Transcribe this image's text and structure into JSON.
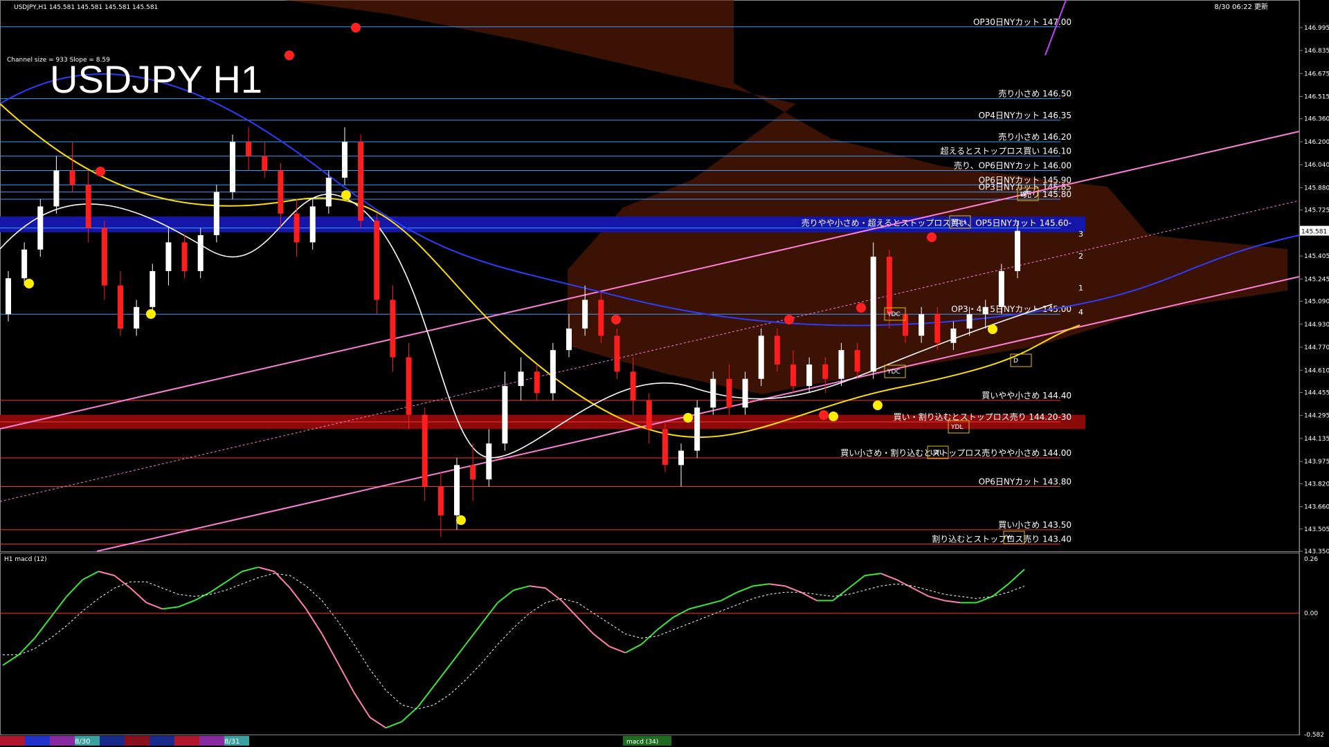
{
  "header": {
    "instrument_line": "USDJPY,H1  145.581 145.581 145.581 145.581",
    "timestamp": "8/30 06:22 更新",
    "channel_info": "Channel size = 933 Slope = 8.59"
  },
  "chart_data": {
    "type": "candlestick",
    "title": "USDJPY H1",
    "last_price": "145.581",
    "main_ylim": [
      143.35,
      147.1
    ],
    "main_ticks": [
      "146.995",
      "146.835",
      "146.675",
      "146.515",
      "146.360",
      "146.200",
      "146.040",
      "145.880",
      "145.725",
      "145.581",
      "145.405",
      "145.245",
      "145.090",
      "144.930",
      "144.770",
      "144.610",
      "144.455",
      "144.295",
      "144.135",
      "143.975",
      "143.820",
      "143.660",
      "143.505",
      "143.350"
    ],
    "levels": [
      {
        "price": 147.0,
        "label": "OP30日NYカット 147.00",
        "color": "#3a9bff"
      },
      {
        "price": 146.5,
        "label": "売り小さめ 146.50",
        "color": "#3a9bff"
      },
      {
        "price": 146.35,
        "label": "OP4日NYカット 146.35",
        "color": "#3a9bff"
      },
      {
        "price": 146.2,
        "label": "売り小さめ 146.20",
        "color": "#3a9bff"
      },
      {
        "price": 146.1,
        "label": "超えるとストップロス買い 146.10",
        "color": "#3a9bff"
      },
      {
        "price": 146.0,
        "label": "売り、OP6日NYカット 146.00",
        "color": "#3a9bff"
      },
      {
        "price": 145.9,
        "label": "OP6日NYカット 145.90",
        "color": "#3a9bff"
      },
      {
        "price": 145.85,
        "label": "OP3日NYカット 145.85",
        "color": "#3a9bff"
      },
      {
        "price": 145.8,
        "label": "売り 145.80",
        "color": "#3a9bff"
      },
      {
        "price": 145.6,
        "label": "売りやや小さめ・超えるとストップロス買い、OP5日NYカット 145.60-",
        "color": "#3a9bff"
      },
      {
        "price": 145.0,
        "label": "OP3・4・5日NYカット 145.00",
        "color": "#3a9bff"
      },
      {
        "price": 144.4,
        "label": "買いやや小さめ 144.40",
        "color": "#ff3030"
      },
      {
        "price": 144.25,
        "label": "買い・割り込むとストップロス売り 144.20-30",
        "color": "#ff3030"
      },
      {
        "price": 144.0,
        "label": "買い小さめ・割り込むとストップロス売りやや小さめ 144.00",
        "color": "#ff3030"
      },
      {
        "price": 143.8,
        "label": "OP6日NYカット 143.80",
        "color": "#ff3030"
      },
      {
        "price": 143.5,
        "label": "買い小さめ 143.50",
        "color": "#ff3030"
      },
      {
        "price": 143.4,
        "label": "割り込むとストップロス売り 143.40",
        "color": "#ff3030"
      }
    ],
    "zones": [
      {
        "from": 145.57,
        "to": 145.68,
        "color": "#1515a8"
      },
      {
        "from": 144.2,
        "to": 144.3,
        "color": "#8b0a0a"
      }
    ],
    "box_labels": [
      "YDH",
      "YDC",
      "YDC",
      "YDL",
      "LWL",
      "W",
      "D",
      "D",
      "W"
    ],
    "wave_labels": [
      "1",
      "2",
      "3",
      "4"
    ],
    "candles": [
      [
        145.0,
        145.3,
        144.95,
        145.25
      ],
      [
        145.25,
        145.5,
        145.2,
        145.45
      ],
      [
        145.45,
        145.8,
        145.4,
        145.75
      ],
      [
        145.75,
        146.1,
        145.7,
        146.0
      ],
      [
        146.0,
        146.2,
        145.85,
        145.9
      ],
      [
        145.9,
        146.0,
        145.5,
        145.6
      ],
      [
        145.6,
        145.65,
        145.1,
        145.2
      ],
      [
        145.2,
        145.3,
        144.85,
        144.9
      ],
      [
        144.9,
        145.1,
        144.85,
        145.05
      ],
      [
        145.05,
        145.35,
        145.0,
        145.3
      ],
      [
        145.3,
        145.6,
        145.2,
        145.5
      ],
      [
        145.5,
        145.55,
        145.25,
        145.3
      ],
      [
        145.3,
        145.6,
        145.25,
        145.55
      ],
      [
        145.55,
        145.9,
        145.5,
        145.85
      ],
      [
        145.85,
        146.25,
        145.8,
        146.2
      ],
      [
        146.2,
        146.3,
        146.0,
        146.1
      ],
      [
        146.1,
        146.2,
        145.95,
        146.0
      ],
      [
        146.0,
        146.05,
        145.6,
        145.7
      ],
      [
        145.7,
        145.8,
        145.4,
        145.5
      ],
      [
        145.5,
        145.8,
        145.45,
        145.75
      ],
      [
        145.75,
        146.0,
        145.7,
        145.95
      ],
      [
        145.95,
        146.3,
        145.9,
        146.2
      ],
      [
        146.2,
        146.25,
        145.6,
        145.65
      ],
      [
        145.65,
        145.7,
        145.0,
        145.1
      ],
      [
        145.1,
        145.2,
        144.6,
        144.7
      ],
      [
        144.7,
        144.8,
        144.2,
        144.3
      ],
      [
        144.3,
        144.35,
        143.7,
        143.8
      ],
      [
        143.8,
        143.9,
        143.45,
        143.6
      ],
      [
        143.6,
        144.0,
        143.5,
        143.95
      ],
      [
        143.95,
        144.1,
        143.7,
        143.85
      ],
      [
        143.85,
        144.2,
        143.8,
        144.1
      ],
      [
        144.1,
        144.6,
        144.05,
        144.5
      ],
      [
        144.5,
        144.7,
        144.4,
        144.6
      ],
      [
        144.6,
        144.65,
        144.4,
        144.45
      ],
      [
        144.45,
        144.8,
        144.4,
        144.75
      ],
      [
        144.75,
        145.0,
        144.7,
        144.9
      ],
      [
        144.9,
        145.2,
        144.85,
        145.1
      ],
      [
        145.1,
        145.15,
        144.8,
        144.85
      ],
      [
        144.85,
        144.9,
        144.55,
        144.6
      ],
      [
        144.6,
        144.7,
        144.3,
        144.4
      ],
      [
        144.4,
        144.45,
        144.1,
        144.2
      ],
      [
        144.2,
        144.25,
        143.9,
        143.95
      ],
      [
        143.95,
        144.1,
        143.8,
        144.05
      ],
      [
        144.05,
        144.4,
        144.0,
        144.35
      ],
      [
        144.35,
        144.6,
        144.3,
        144.55
      ],
      [
        144.55,
        144.65,
        144.3,
        144.35
      ],
      [
        144.35,
        144.6,
        144.3,
        144.55
      ],
      [
        144.55,
        144.9,
        144.5,
        144.85
      ],
      [
        144.85,
        144.9,
        144.6,
        144.65
      ],
      [
        144.65,
        144.75,
        144.45,
        144.5
      ],
      [
        144.5,
        144.7,
        144.45,
        144.65
      ],
      [
        144.65,
        144.7,
        144.45,
        144.55
      ],
      [
        144.55,
        144.8,
        144.5,
        144.75
      ],
      [
        144.75,
        144.8,
        144.55,
        144.6
      ],
      [
        144.6,
        145.5,
        144.55,
        145.4
      ],
      [
        145.4,
        145.45,
        144.9,
        145.0
      ],
      [
        145.0,
        145.05,
        144.8,
        144.85
      ],
      [
        144.85,
        145.05,
        144.8,
        145.0
      ],
      [
        145.0,
        145.05,
        144.75,
        144.8
      ],
      [
        144.8,
        144.95,
        144.75,
        144.9
      ],
      [
        144.9,
        145.05,
        144.85,
        145.0
      ],
      [
        145.0,
        145.1,
        144.9,
        145.05
      ],
      [
        145.05,
        145.35,
        145.0,
        145.3
      ],
      [
        145.3,
        145.65,
        145.25,
        145.58
      ]
    ],
    "macd": {
      "label": "H1 macd (12)",
      "ylim": [
        -0.582,
        0.26
      ],
      "ticks": [
        "0.26",
        "0.00",
        "-0.582"
      ],
      "main": [
        -0.25,
        -0.2,
        -0.12,
        -0.02,
        0.08,
        0.16,
        0.2,
        0.18,
        0.12,
        0.05,
        0.02,
        0.03,
        0.06,
        0.1,
        0.15,
        0.2,
        0.22,
        0.2,
        0.12,
        0.02,
        -0.1,
        -0.24,
        -0.38,
        -0.5,
        -0.55,
        -0.52,
        -0.45,
        -0.35,
        -0.25,
        -0.15,
        -0.05,
        0.05,
        0.11,
        0.13,
        0.12,
        0.06,
        -0.02,
        -0.1,
        -0.16,
        -0.19,
        -0.15,
        -0.08,
        -0.02,
        0.02,
        0.04,
        0.06,
        0.1,
        0.13,
        0.14,
        0.13,
        0.1,
        0.06,
        0.06,
        0.12,
        0.18,
        0.19,
        0.16,
        0.12,
        0.08,
        0.06,
        0.05,
        0.05,
        0.08,
        0.14,
        0.21
      ],
      "signal": [
        -0.2,
        -0.2,
        -0.17,
        -0.12,
        -0.06,
        0.01,
        0.07,
        0.12,
        0.15,
        0.15,
        0.12,
        0.09,
        0.08,
        0.09,
        0.11,
        0.14,
        0.17,
        0.19,
        0.18,
        0.13,
        0.06,
        -0.04,
        -0.15,
        -0.27,
        -0.37,
        -0.44,
        -0.46,
        -0.44,
        -0.39,
        -0.32,
        -0.24,
        -0.15,
        -0.07,
        0.0,
        0.05,
        0.07,
        0.05,
        0.0,
        -0.05,
        -0.1,
        -0.12,
        -0.11,
        -0.08,
        -0.05,
        -0.02,
        0.01,
        0.04,
        0.07,
        0.09,
        0.1,
        0.1,
        0.09,
        0.08,
        0.09,
        0.11,
        0.13,
        0.14,
        0.13,
        0.11,
        0.09,
        0.08,
        0.07,
        0.08,
        0.1,
        0.13
      ]
    },
    "date_labels": [
      "8/30",
      "8/31"
    ],
    "indicator_tab": "macd (34)"
  }
}
